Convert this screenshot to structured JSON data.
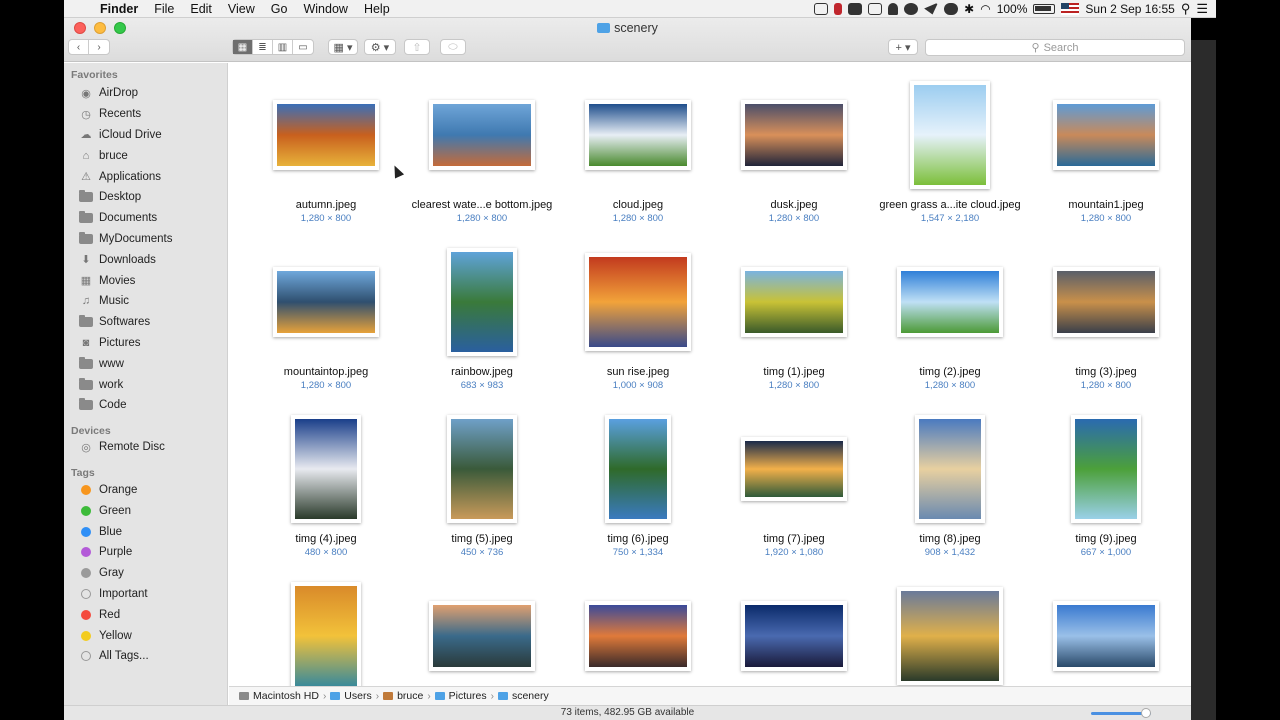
{
  "menubar": {
    "app": "Finder",
    "items": [
      "File",
      "Edit",
      "View",
      "Go",
      "Window",
      "Help"
    ],
    "battery": "100%",
    "clock": "Sun 2 Sep  16:55"
  },
  "window": {
    "title": "scenery",
    "search_placeholder": "Search"
  },
  "sidebar": {
    "favorites_title": "Favorites",
    "favorites": [
      {
        "label": "AirDrop",
        "icon": "airdrop-icon"
      },
      {
        "label": "Recents",
        "icon": "clock-icon"
      },
      {
        "label": "iCloud Drive",
        "icon": "cloud-icon"
      },
      {
        "label": "bruce",
        "icon": "home-icon"
      },
      {
        "label": "Applications",
        "icon": "applications-icon"
      },
      {
        "label": "Desktop",
        "icon": "folder-icon"
      },
      {
        "label": "Documents",
        "icon": "folder-icon"
      },
      {
        "label": "MyDocuments",
        "icon": "folder-icon"
      },
      {
        "label": "Downloads",
        "icon": "download-icon"
      },
      {
        "label": "Movies",
        "icon": "film-icon"
      },
      {
        "label": "Music",
        "icon": "music-icon"
      },
      {
        "label": "Softwares",
        "icon": "folder-icon"
      },
      {
        "label": "Pictures",
        "icon": "camera-icon"
      },
      {
        "label": "www",
        "icon": "folder-icon"
      },
      {
        "label": "work",
        "icon": "folder-icon"
      },
      {
        "label": "Code",
        "icon": "folder-icon"
      }
    ],
    "devices_title": "Devices",
    "devices": [
      {
        "label": "Remote Disc",
        "icon": "disc-icon"
      }
    ],
    "tags_title": "Tags",
    "tags": [
      {
        "label": "Orange",
        "color": "#f7961e"
      },
      {
        "label": "Green",
        "color": "#3dbb3a"
      },
      {
        "label": "Blue",
        "color": "#2f8ff6"
      },
      {
        "label": "Purple",
        "color": "#b35ad8"
      },
      {
        "label": "Gray",
        "color": "#9a9a9a"
      },
      {
        "label": "Important",
        "color": "none"
      },
      {
        "label": "Red",
        "color": "#f44b3e"
      },
      {
        "label": "Yellow",
        "color": "#f3cc1f"
      },
      {
        "label": "All Tags...",
        "color": "none"
      }
    ]
  },
  "files": [
    {
      "name": "autumn.jpeg",
      "dims": "1,280 × 800",
      "shape": "landscape",
      "colors": [
        "#3a6fb8",
        "#c8601e",
        "#e7b23a"
      ]
    },
    {
      "name": "clearest wate...e bottom.jpeg",
      "dims": "1,280 × 800",
      "shape": "landscape",
      "colors": [
        "#6fa5d8",
        "#3f79b0",
        "#c46b3a"
      ]
    },
    {
      "name": "cloud.jpeg",
      "dims": "1,280 × 800",
      "shape": "landscape",
      "colors": [
        "#1f4e8c",
        "#e8eef5",
        "#4a8a2e"
      ]
    },
    {
      "name": "dusk.jpeg",
      "dims": "1,280 × 800",
      "shape": "landscape",
      "colors": [
        "#4a4e6a",
        "#d9905a",
        "#20243a"
      ]
    },
    {
      "name": "green grass a...ite cloud.jpeg",
      "dims": "1,547 × 2,180",
      "shape": "portrait-tall",
      "colors": [
        "#9ccdf0",
        "#e6f2fb",
        "#7cbf3a"
      ]
    },
    {
      "name": "mountain1.jpeg",
      "dims": "1,280 × 800",
      "shape": "landscape",
      "colors": [
        "#5e9bd6",
        "#c98a5a",
        "#2a6a98"
      ]
    },
    {
      "name": "mountaintop.jpeg",
      "dims": "1,280 × 800",
      "shape": "landscape",
      "colors": [
        "#6fa8dc",
        "#2f4f6f",
        "#e7a23a"
      ]
    },
    {
      "name": "rainbow.jpeg",
      "dims": "683 × 983",
      "shape": "portrait",
      "colors": [
        "#5fa3d9",
        "#3a7a3a",
        "#2a5f9f"
      ]
    },
    {
      "name": "sun rise.jpeg",
      "dims": "1,000 × 908",
      "shape": "square",
      "colors": [
        "#c23a1e",
        "#f2a33a",
        "#3a4a8a"
      ]
    },
    {
      "name": "timg (1).jpeg",
      "dims": "1,280 × 800",
      "shape": "landscape",
      "colors": [
        "#7ab3e0",
        "#c9c236",
        "#3a5a2a"
      ]
    },
    {
      "name": "timg (2).jpeg",
      "dims": "1,280 × 800",
      "shape": "landscape",
      "colors": [
        "#2f7fd8",
        "#bfe0f5",
        "#4c9a36"
      ]
    },
    {
      "name": "timg (3).jpeg",
      "dims": "1,280 × 800",
      "shape": "landscape",
      "colors": [
        "#5a5f6a",
        "#c9904a",
        "#3a3f4a"
      ]
    },
    {
      "name": "timg (4).jpeg",
      "dims": "480 × 800",
      "shape": "portrait",
      "colors": [
        "#1a3f8a",
        "#e8eaf0",
        "#2a3a2a"
      ]
    },
    {
      "name": "timg (5).jpeg",
      "dims": "450 × 736",
      "shape": "portrait",
      "colors": [
        "#6fa0c8",
        "#3a5a3a",
        "#c99a5a"
      ]
    },
    {
      "name": "timg (6).jpeg",
      "dims": "750 × 1,334",
      "shape": "portrait-narrow",
      "colors": [
        "#5aa0e0",
        "#2f6a2a",
        "#3a7ac0"
      ]
    },
    {
      "name": "timg (7).jpeg",
      "dims": "1,920 × 1,080",
      "shape": "wide",
      "colors": [
        "#1a2a4a",
        "#f2b04a",
        "#2f5a3a"
      ]
    },
    {
      "name": "timg (8).jpeg",
      "dims": "908 × 1,432",
      "shape": "portrait",
      "colors": [
        "#4a7ac0",
        "#e8d0a0",
        "#6a8ab0"
      ]
    },
    {
      "name": "timg (9).jpeg",
      "dims": "667 × 1,000",
      "shape": "portrait",
      "colors": [
        "#2a6ab0",
        "#4ca03a",
        "#9ad0e8"
      ]
    },
    {
      "name": "",
      "dims": "",
      "shape": "portrait",
      "colors": [
        "#d98a2a",
        "#f2c23a",
        "#3a8a9a"
      ]
    },
    {
      "name": "",
      "dims": "",
      "shape": "landscape",
      "colors": [
        "#e0a070",
        "#3a6a8a",
        "#2a3a3a"
      ]
    },
    {
      "name": "",
      "dims": "",
      "shape": "landscape",
      "colors": [
        "#3a4a9a",
        "#e07a3a",
        "#3a2a2a"
      ]
    },
    {
      "name": "",
      "dims": "",
      "shape": "landscape",
      "colors": [
        "#0a2a6a",
        "#4a6ab0",
        "#1a1a3a"
      ]
    },
    {
      "name": "",
      "dims": "",
      "shape": "square",
      "colors": [
        "#6a7a9a",
        "#e0b04a",
        "#2a3a2a"
      ]
    },
    {
      "name": "",
      "dims": "",
      "shape": "landscape",
      "colors": [
        "#3a7ad0",
        "#9ac0e8",
        "#2a4a6a"
      ]
    }
  ],
  "pathbar": [
    {
      "label": "Macintosh HD",
      "icon": "hard-drive-icon",
      "color": "#8a8a8a"
    },
    {
      "label": "Users",
      "icon": "folder-icon",
      "color": "#4ea2e6"
    },
    {
      "label": "bruce",
      "icon": "home-icon",
      "color": "#c07a3a"
    },
    {
      "label": "Pictures",
      "icon": "folder-icon",
      "color": "#4ea2e6"
    },
    {
      "label": "scenery",
      "icon": "folder-icon",
      "color": "#4ea2e6"
    }
  ],
  "status": "73 items, 482.95 GB available"
}
